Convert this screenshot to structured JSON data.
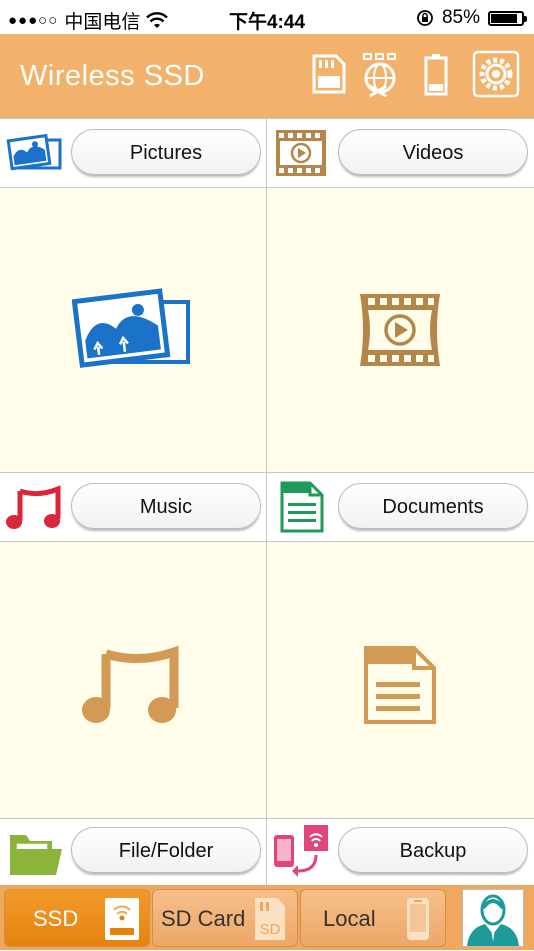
{
  "status": {
    "signal": "●●●○○",
    "carrier": "中国电信",
    "time": "下午4:44",
    "battery": "85%",
    "battery_level": 0.85
  },
  "header": {
    "title": "Wireless SSD",
    "icons": [
      "sd-card-icon",
      "network-off-icon",
      "battery-icon",
      "settings-icon"
    ]
  },
  "tiles": {
    "pictures": {
      "label": "Pictures",
      "color": "#1a73c8"
    },
    "videos": {
      "label": "Videos",
      "color": "#b5864a"
    },
    "music": {
      "label": "Music",
      "color": "#d9263a"
    },
    "documents": {
      "label": "Documents",
      "color": "#1f9a5a"
    },
    "file_folder": {
      "label": "File/Folder",
      "color": "#8bb43a"
    },
    "backup": {
      "label": "Backup",
      "color": "#e0457c"
    }
  },
  "big_icon_color": "#d29a55",
  "tabbar": {
    "ssd": "SSD",
    "sd_card": "SD Card",
    "local": "Local",
    "sd_badge": "SD"
  }
}
